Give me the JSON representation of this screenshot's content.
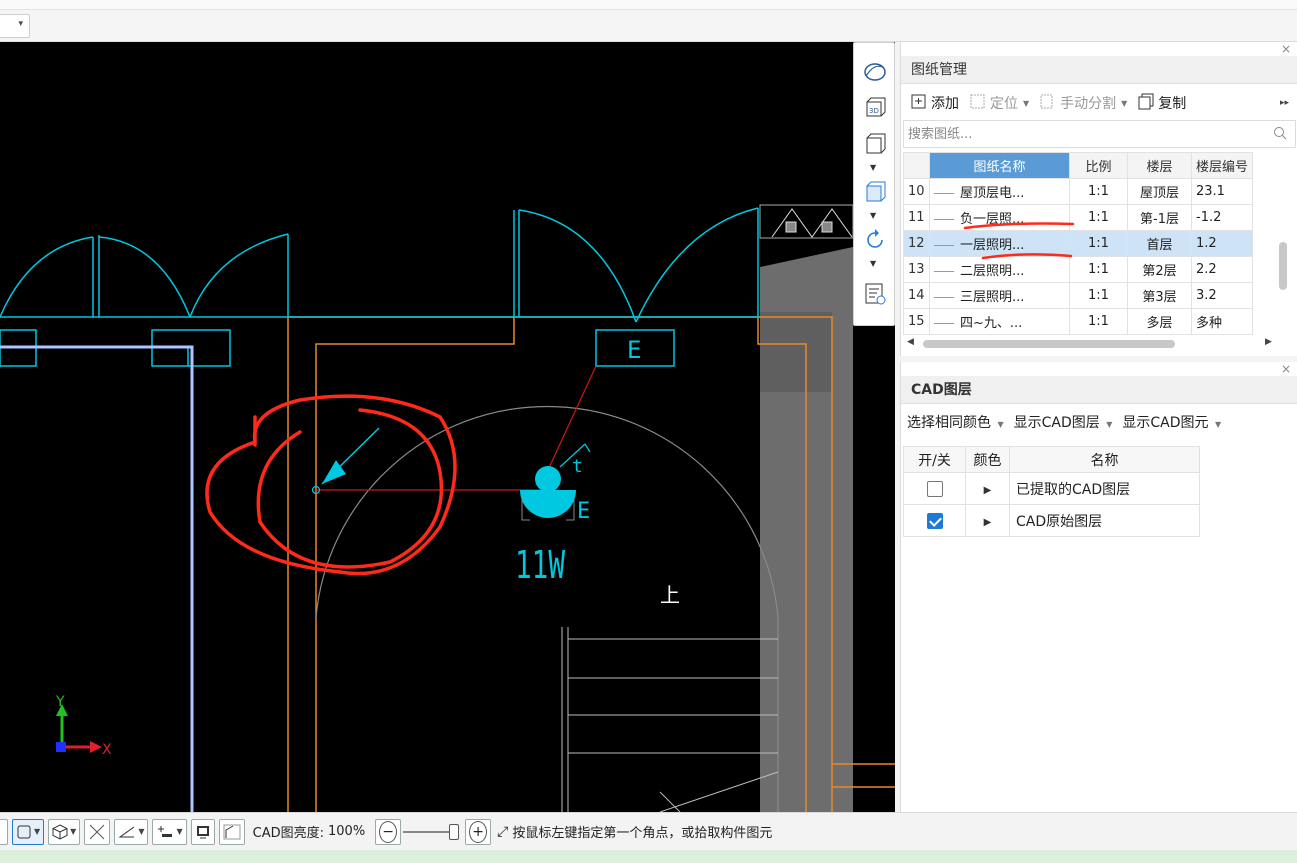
{
  "top_toolbar": {
    "dropdown_caret": "▾"
  },
  "drawing_panel": {
    "title": "图纸管理",
    "close": "×",
    "toolbar": {
      "add": "添加",
      "locate": "定位",
      "manual_split": "手动分割",
      "copy": "复制",
      "more": "▸▸"
    },
    "search_placeholder": "搜索图纸...",
    "columns": [
      "",
      "图纸名称",
      "比例",
      "楼层",
      "楼层编号"
    ],
    "rows": [
      {
        "num": "10",
        "name": "屋顶层电...",
        "scale": "1:1",
        "floor": "屋顶层",
        "code": "23.1"
      },
      {
        "num": "11",
        "name": "负一层照...",
        "scale": "1:1",
        "floor": "第-1层",
        "code": "-1.2"
      },
      {
        "num": "12",
        "name": "一层照明...",
        "scale": "1:1",
        "floor": "首层",
        "code": "1.2",
        "selected": true
      },
      {
        "num": "13",
        "name": "二层照明...",
        "scale": "1:1",
        "floor": "第2层",
        "code": "2.2"
      },
      {
        "num": "14",
        "name": "三层照明...",
        "scale": "1:1",
        "floor": "第3层",
        "code": "3.2"
      },
      {
        "num": "15",
        "name": "四~九、...",
        "scale": "1:1",
        "floor": "多层",
        "code": "多种"
      }
    ]
  },
  "layer_panel": {
    "title": "CAD图层",
    "close": "×",
    "toolbar": [
      "选择相同颜色",
      "显示CAD图层",
      "显示CAD图元"
    ],
    "columns": [
      "开/关",
      "颜色",
      "名称"
    ],
    "rows": [
      {
        "checked": false,
        "name": "已提取的CAD图层"
      },
      {
        "checked": true,
        "name": "CAD原始图层"
      }
    ]
  },
  "canvas": {
    "labels": {
      "e_tag": "E",
      "power": "11W",
      "t_tag": "t",
      "up_mark": "上",
      "axis_x": "X",
      "axis_y": "Y"
    }
  },
  "bottom_bar": {
    "brightness_label": "CAD图亮度:",
    "brightness_value": "100%",
    "prompt": "按鼠标左键指定第一个角点，或拾取构件图元"
  },
  "colors": {
    "accent": "#1f7ad6",
    "cad_cyan": "#00c8e0",
    "cad_orange": "#e8892c",
    "annotation_red": "#ff2a1a",
    "header_blue": "#5b9bd5"
  }
}
